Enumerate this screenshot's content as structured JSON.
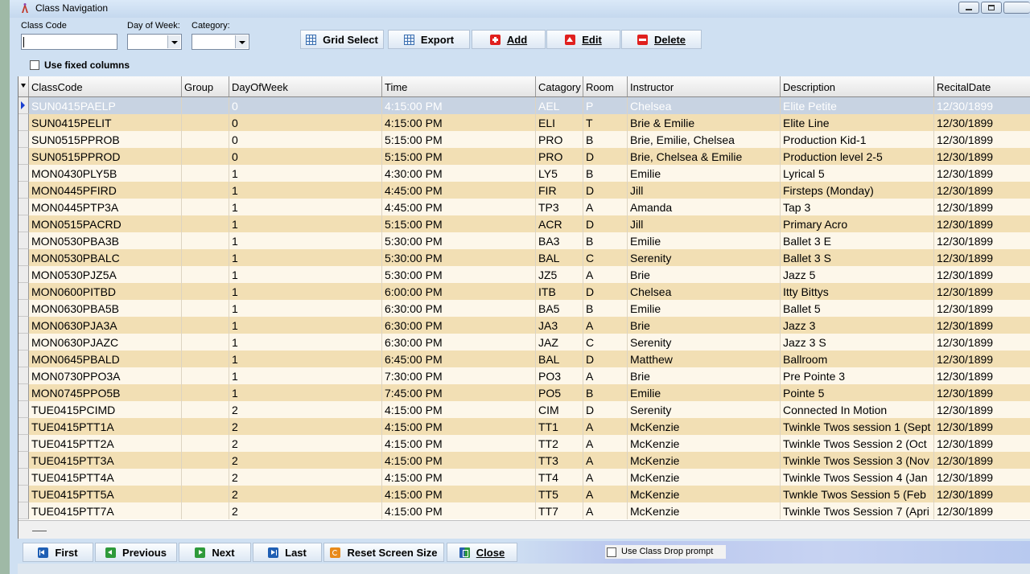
{
  "window": {
    "title": "Class Navigation"
  },
  "filters": {
    "class_code_label": "Class Code",
    "day_of_week_label": "Day of Week:",
    "category_label": "Category:",
    "class_code_value": "",
    "day_of_week_value": "",
    "category_value": "",
    "fixed_columns_label": "Use fixed columns"
  },
  "toolbar": {
    "grid_select": "Grid Select",
    "export": "Export",
    "add": "Add",
    "edit": "Edit",
    "delete": "Delete"
  },
  "grid": {
    "columns": [
      "ClassCode",
      "Group",
      "DayOfWeek",
      "Time",
      "Catagory",
      "Room",
      "Instructor",
      "Description",
      "RecitalDate"
    ],
    "rows": [
      [
        "SUN0415PAELP",
        "",
        "0",
        "4:15:00 PM",
        "AEL",
        "P",
        "Chelsea",
        "Elite Petite",
        "12/30/1899"
      ],
      [
        "SUN0415PELIT",
        "",
        "0",
        "4:15:00 PM",
        "ELI",
        "T",
        "Brie & Emilie",
        "Elite Line",
        "12/30/1899"
      ],
      [
        "SUN0515PPROB",
        "",
        "0",
        "5:15:00 PM",
        "PRO",
        "B",
        "Brie, Emilie, Chelsea",
        "Production Kid-1",
        "12/30/1899"
      ],
      [
        "SUN0515PPROD",
        "",
        "0",
        "5:15:00 PM",
        "PRO",
        "D",
        "Brie, Chelsea & Emilie",
        "Production level 2-5",
        "12/30/1899"
      ],
      [
        "MON0430PLY5B",
        "",
        "1",
        "4:30:00 PM",
        "LY5",
        "B",
        "Emilie",
        "Lyrical 5",
        "12/30/1899"
      ],
      [
        "MON0445PFIRD",
        "",
        "1",
        "4:45:00 PM",
        "FIR",
        "D",
        "Jill",
        "Firsteps (Monday)",
        "12/30/1899"
      ],
      [
        "MON0445PTP3A",
        "",
        "1",
        "4:45:00 PM",
        "TP3",
        "A",
        "Amanda",
        "Tap 3",
        "12/30/1899"
      ],
      [
        "MON0515PACRD",
        "",
        "1",
        "5:15:00 PM",
        "ACR",
        "D",
        "Jill",
        "Primary Acro",
        "12/30/1899"
      ],
      [
        "MON0530PBA3B",
        "",
        "1",
        "5:30:00 PM",
        "BA3",
        "B",
        "Emilie",
        "Ballet 3 E",
        "12/30/1899"
      ],
      [
        "MON0530PBALC",
        "",
        "1",
        "5:30:00 PM",
        "BAL",
        "C",
        "Serenity",
        "Ballet 3 S",
        "12/30/1899"
      ],
      [
        "MON0530PJZ5A",
        "",
        "1",
        "5:30:00 PM",
        "JZ5",
        "A",
        "Brie",
        "Jazz 5",
        "12/30/1899"
      ],
      [
        "MON0600PITBD",
        "",
        "1",
        "6:00:00 PM",
        "ITB",
        "D",
        "Chelsea",
        "Itty Bittys",
        "12/30/1899"
      ],
      [
        "MON0630PBA5B",
        "",
        "1",
        "6:30:00 PM",
        "BA5",
        "B",
        "Emilie",
        "Ballet 5",
        "12/30/1899"
      ],
      [
        "MON0630PJA3A",
        "",
        "1",
        "6:30:00 PM",
        "JA3",
        "A",
        "Brie",
        "Jazz 3",
        "12/30/1899"
      ],
      [
        "MON0630PJAZC",
        "",
        "1",
        "6:30:00 PM",
        "JAZ",
        "C",
        "Serenity",
        "Jazz 3 S",
        "12/30/1899"
      ],
      [
        "MON0645PBALD",
        "",
        "1",
        "6:45:00 PM",
        "BAL",
        "D",
        "Matthew",
        "Ballroom",
        "12/30/1899"
      ],
      [
        "MON0730PPO3A",
        "",
        "1",
        "7:30:00 PM",
        "PO3",
        "A",
        "Brie",
        "Pre Pointe 3",
        "12/30/1899"
      ],
      [
        "MON0745PPO5B",
        "",
        "1",
        "7:45:00 PM",
        "PO5",
        "B",
        "Emilie",
        "Pointe 5",
        "12/30/1899"
      ],
      [
        "TUE0415PCIMD",
        "",
        "2",
        "4:15:00 PM",
        "CIM",
        "D",
        "Serenity",
        "Connected In Motion",
        "12/30/1899"
      ],
      [
        "TUE0415PTT1A",
        "",
        "2",
        "4:15:00 PM",
        "TT1",
        "A",
        "McKenzie",
        "Twinkle Twos session 1 (Sept",
        "12/30/1899"
      ],
      [
        "TUE0415PTT2A",
        "",
        "2",
        "4:15:00 PM",
        "TT2",
        "A",
        "McKenzie",
        "Twinkle Twos Session 2 (Oct",
        "12/30/1899"
      ],
      [
        "TUE0415PTT3A",
        "",
        "2",
        "4:15:00 PM",
        "TT3",
        "A",
        "McKenzie",
        "Twinkle Twos Session 3 (Nov",
        "12/30/1899"
      ],
      [
        "TUE0415PTT4A",
        "",
        "2",
        "4:15:00 PM",
        "TT4",
        "A",
        "McKenzie",
        "Twinkle Twos Session 4 (Jan",
        "12/30/1899"
      ],
      [
        "TUE0415PTT5A",
        "",
        "2",
        "4:15:00 PM",
        "TT5",
        "A",
        "McKenzie",
        "Twnkle Twos Session 5 (Feb",
        "12/30/1899"
      ],
      [
        "TUE0415PTT7A",
        "",
        "2",
        "4:15:00 PM",
        "TT7",
        "A",
        "McKenzie",
        "Twinkle Twos Session 7 (Apri",
        "12/30/1899"
      ]
    ]
  },
  "nav": {
    "first": "First",
    "previous": "Previous",
    "next": "Next",
    "last": "Last",
    "reset": "Reset Screen Size",
    "close": "Close",
    "drop_prompt": "Use Class Drop prompt"
  },
  "colors": {
    "selected_row": "#c8d3e2",
    "alt_row": "#f2dfb4",
    "normal_row": "#fdf7ea",
    "accent_red": "#e0201e"
  }
}
